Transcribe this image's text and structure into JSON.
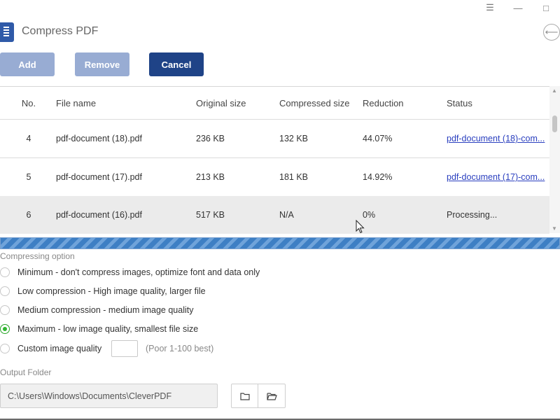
{
  "window": {
    "title": "Compress PDF",
    "controls": {
      "menu_glyph": "☰",
      "minimize_glyph": "—",
      "maximize_glyph": "□"
    },
    "back_glyph": "⟵"
  },
  "toolbar": {
    "add_label": "Add",
    "remove_label": "Remove",
    "cancel_label": "Cancel"
  },
  "table": {
    "headers": {
      "no": "No.",
      "name": "File name",
      "original": "Original size",
      "compressed": "Compressed size",
      "reduction": "Reduction",
      "status": "Status"
    },
    "rows": [
      {
        "no": "4",
        "name": "pdf-document (18).pdf",
        "original": "236 KB",
        "compressed": "132 KB",
        "reduction": "44.07%",
        "status": "pdf-document (18)-com..."
      },
      {
        "no": "5",
        "name": "pdf-document (17).pdf",
        "original": "213 KB",
        "compressed": "181 KB",
        "reduction": "14.92%",
        "status": "pdf-document (17)-com..."
      },
      {
        "no": "6",
        "name": "pdf-document (16).pdf",
        "original": "517 KB",
        "compressed": "N/A",
        "reduction": "0%",
        "status": "Processing..."
      }
    ]
  },
  "progress": {
    "fraction": 1.0
  },
  "options": {
    "label": "Compressing option",
    "items": [
      {
        "label": "Minimum - don't compress images, optimize font and data only",
        "checked": false
      },
      {
        "label": "Low compression - High image quality, larger file",
        "checked": false
      },
      {
        "label": "Medium compression - medium image quality",
        "checked": false
      },
      {
        "label": "Maximum - low image quality, smallest file size",
        "checked": true
      },
      {
        "label": "Custom image quality",
        "checked": false
      }
    ],
    "custom_quality_value": "",
    "custom_quality_hint": "(Poor 1-100 best)"
  },
  "output": {
    "label": "Output Folder",
    "path": "C:\\Users\\Windows\\Documents\\CleverPDF"
  },
  "colors": {
    "accent": "#1f4387",
    "button_disabled": "#98acd3",
    "link": "#2a3fbf",
    "radio_checked": "#2fb52f"
  }
}
